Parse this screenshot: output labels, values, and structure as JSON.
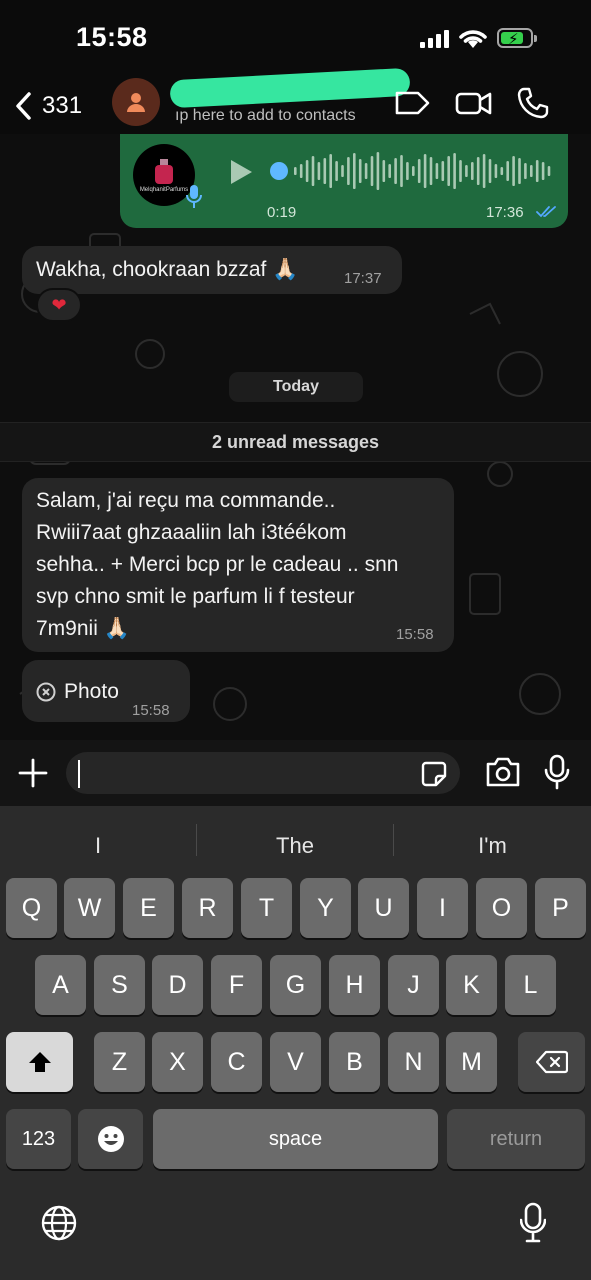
{
  "status_bar": {
    "time": "15:58"
  },
  "header": {
    "back_count": "331",
    "contact_subtitle": "ıp here to add to contacts"
  },
  "chat": {
    "voice_message": {
      "duration": "0:19",
      "time": "17:36",
      "brand_text": "MelqhanitParfums"
    },
    "msg1": {
      "text": "Wakha, chookraan bzzaf 🙏🏻",
      "time": "17:37",
      "reaction": "❤"
    },
    "date_chip": "Today",
    "unread_banner": "2 unread messages",
    "msg2": {
      "lines": [
        "Salam, j'ai reçu ma commande..",
        "Rwiii7aat ghzaaaliin lah i3téékom",
        "sehha.. + Merci bcp pr le cadeau .. snn",
        "svp chno smit le parfum li f testeur",
        "7m9nii 🙏🏻"
      ],
      "time": "15:58"
    },
    "msg3": {
      "label": "Photo",
      "time": "15:58"
    }
  },
  "keyboard": {
    "suggestions": [
      "I",
      "The",
      "I'm"
    ],
    "row1": [
      "Q",
      "W",
      "E",
      "R",
      "T",
      "Y",
      "U",
      "I",
      "O",
      "P"
    ],
    "row2": [
      "A",
      "S",
      "D",
      "F",
      "G",
      "H",
      "J",
      "K",
      "L"
    ],
    "row3": [
      "Z",
      "X",
      "C",
      "V",
      "B",
      "N",
      "M"
    ],
    "numbers_label": "123",
    "space_label": "space",
    "return_label": "return"
  },
  "colors": {
    "outgoing_bubble": "#1f6a3e",
    "incoming_bubble": "#262626",
    "redaction": "#36e6a0"
  }
}
